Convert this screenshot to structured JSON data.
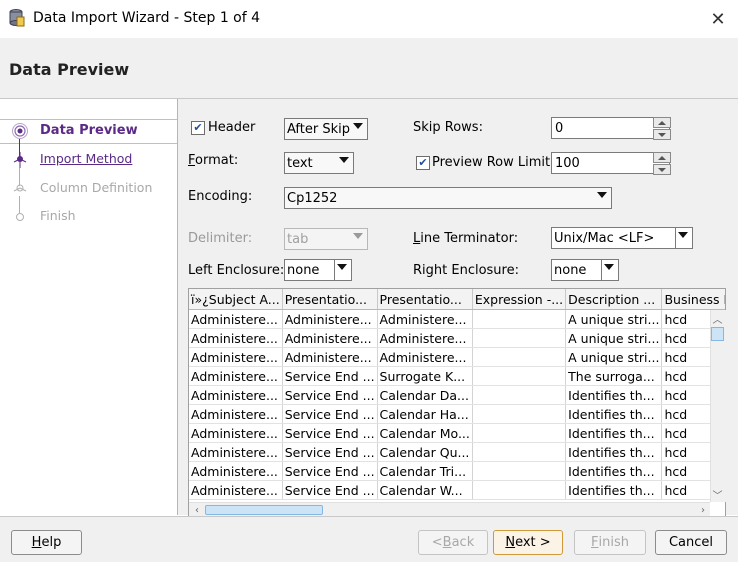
{
  "window": {
    "title": "Data Import Wizard - Step 1 of 4",
    "header_title": "Data Preview"
  },
  "nav": {
    "items": [
      {
        "label": "Data Preview",
        "state": "current"
      },
      {
        "label": "Import Method",
        "state": "link"
      },
      {
        "label": "Column Definition",
        "state": "disabled"
      },
      {
        "label": "Finish",
        "state": "disabled"
      }
    ]
  },
  "options": {
    "header_label": "Header",
    "header_checked": true,
    "header_skip": "After Skip",
    "skip_rows_label": "Skip Rows:",
    "skip_rows_value": "0",
    "format_label": "Format:",
    "format_value": "text",
    "preview_limit_label": "Preview Row Limit:",
    "preview_limit_checked": true,
    "preview_limit_value": "100",
    "encoding_label": "Encoding:",
    "encoding_value": "Cp1252",
    "delimiter_label": "Delimiter:",
    "delimiter_value": "tab",
    "line_terminator_label": "Line Terminator:",
    "line_terminator_value": "Unix/Mac <LF>",
    "left_enclosure_label": "Left Enclosure:",
    "left_enclosure_value": "none",
    "right_enclosure_label": "Right Enclosure:",
    "right_enclosure_value": "none"
  },
  "table": {
    "columns": [
      "ï»¿Subject A...",
      "Presentatio...",
      "Presentatio...",
      "Expression -...",
      "Description ...",
      "Business Mo..."
    ],
    "rows": [
      [
        "Administere...",
        "Administere...",
        "Administere...",
        "",
        "A unique stri...",
        "hcd"
      ],
      [
        "Administere...",
        "Administere...",
        "Administere...",
        "",
        "A unique stri...",
        "hcd"
      ],
      [
        "Administere...",
        "Administere...",
        "Administere...",
        "",
        "A unique stri...",
        "hcd"
      ],
      [
        "Administere...",
        "Service End ...",
        "Surrogate K...",
        "",
        "The surroga...",
        "hcd"
      ],
      [
        "Administere...",
        "Service End ...",
        "Calendar Da...",
        "",
        "Identifies th...",
        "hcd"
      ],
      [
        "Administere...",
        "Service End ...",
        "Calendar Ha...",
        "",
        "Identifies th...",
        "hcd"
      ],
      [
        "Administere...",
        "Service End ...",
        "Calendar Mo...",
        "",
        "Identifies th...",
        "hcd"
      ],
      [
        "Administere...",
        "Service End ...",
        "Calendar Qu...",
        "",
        "Identifies th...",
        "hcd"
      ],
      [
        "Administere...",
        "Service End ...",
        "Calendar Tri...",
        "",
        "Identifies th...",
        "hcd"
      ],
      [
        "Administere...",
        "Service End ...",
        "Calendar W...",
        "",
        "Identifies th...",
        "hcd"
      ]
    ]
  },
  "footer": {
    "help": "Help",
    "back": "< Back",
    "next": "Next >",
    "finish": "Finish",
    "cancel": "Cancel"
  },
  "colors": {
    "nav_current": "#5b2a86",
    "link": "#5b2a86",
    "selected_row": "#ffffff"
  }
}
